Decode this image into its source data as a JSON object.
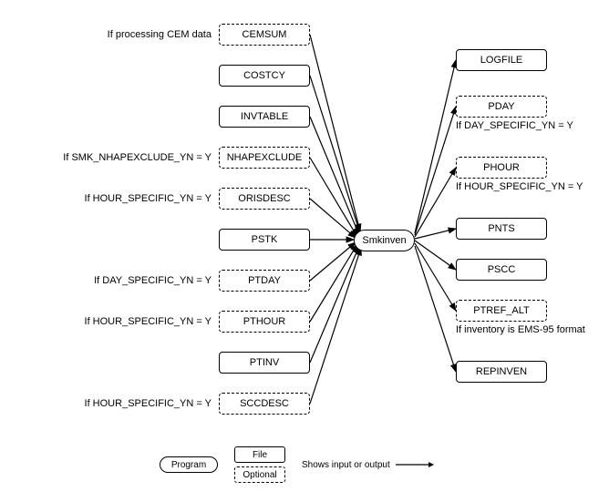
{
  "center": {
    "label": "Smkinven"
  },
  "inputs": [
    {
      "label": "CEMSUM",
      "kind": "optional",
      "cond": "If processing CEM data"
    },
    {
      "label": "COSTCY",
      "kind": "file",
      "cond": ""
    },
    {
      "label": "INVTABLE",
      "kind": "file",
      "cond": ""
    },
    {
      "label": "NHAPEXCLUDE",
      "kind": "optional",
      "cond": "If SMK_NHAPEXCLUDE_YN = Y"
    },
    {
      "label": "ORISDESC",
      "kind": "optional",
      "cond": "If HOUR_SPECIFIC_YN = Y"
    },
    {
      "label": "PSTK",
      "kind": "file",
      "cond": ""
    },
    {
      "label": "PTDAY",
      "kind": "optional",
      "cond": "If DAY_SPECIFIC_YN = Y"
    },
    {
      "label": "PTHOUR",
      "kind": "optional",
      "cond": "If HOUR_SPECIFIC_YN = Y"
    },
    {
      "label": "PTINV",
      "kind": "file",
      "cond": ""
    },
    {
      "label": "SCCDESC",
      "kind": "optional",
      "cond": "If HOUR_SPECIFIC_YN = Y"
    }
  ],
  "outputs": [
    {
      "label": "LOGFILE",
      "kind": "file",
      "cond": ""
    },
    {
      "label": "PDAY",
      "kind": "optional",
      "cond": "If DAY_SPECIFIC_YN = Y"
    },
    {
      "label": "PHOUR",
      "kind": "optional",
      "cond": "If HOUR_SPECIFIC_YN = Y"
    },
    {
      "label": "PNTS",
      "kind": "file",
      "cond": ""
    },
    {
      "label": "PSCC",
      "kind": "file",
      "cond": ""
    },
    {
      "label": "PTREF_ALT",
      "kind": "optional",
      "cond": "If inventory is EMS-95 format"
    },
    {
      "label": "REPINVEN",
      "kind": "file",
      "cond": ""
    }
  ],
  "legend": {
    "program": "Program",
    "file": "File",
    "optional": "Optional",
    "arrow": "Shows input or output"
  }
}
